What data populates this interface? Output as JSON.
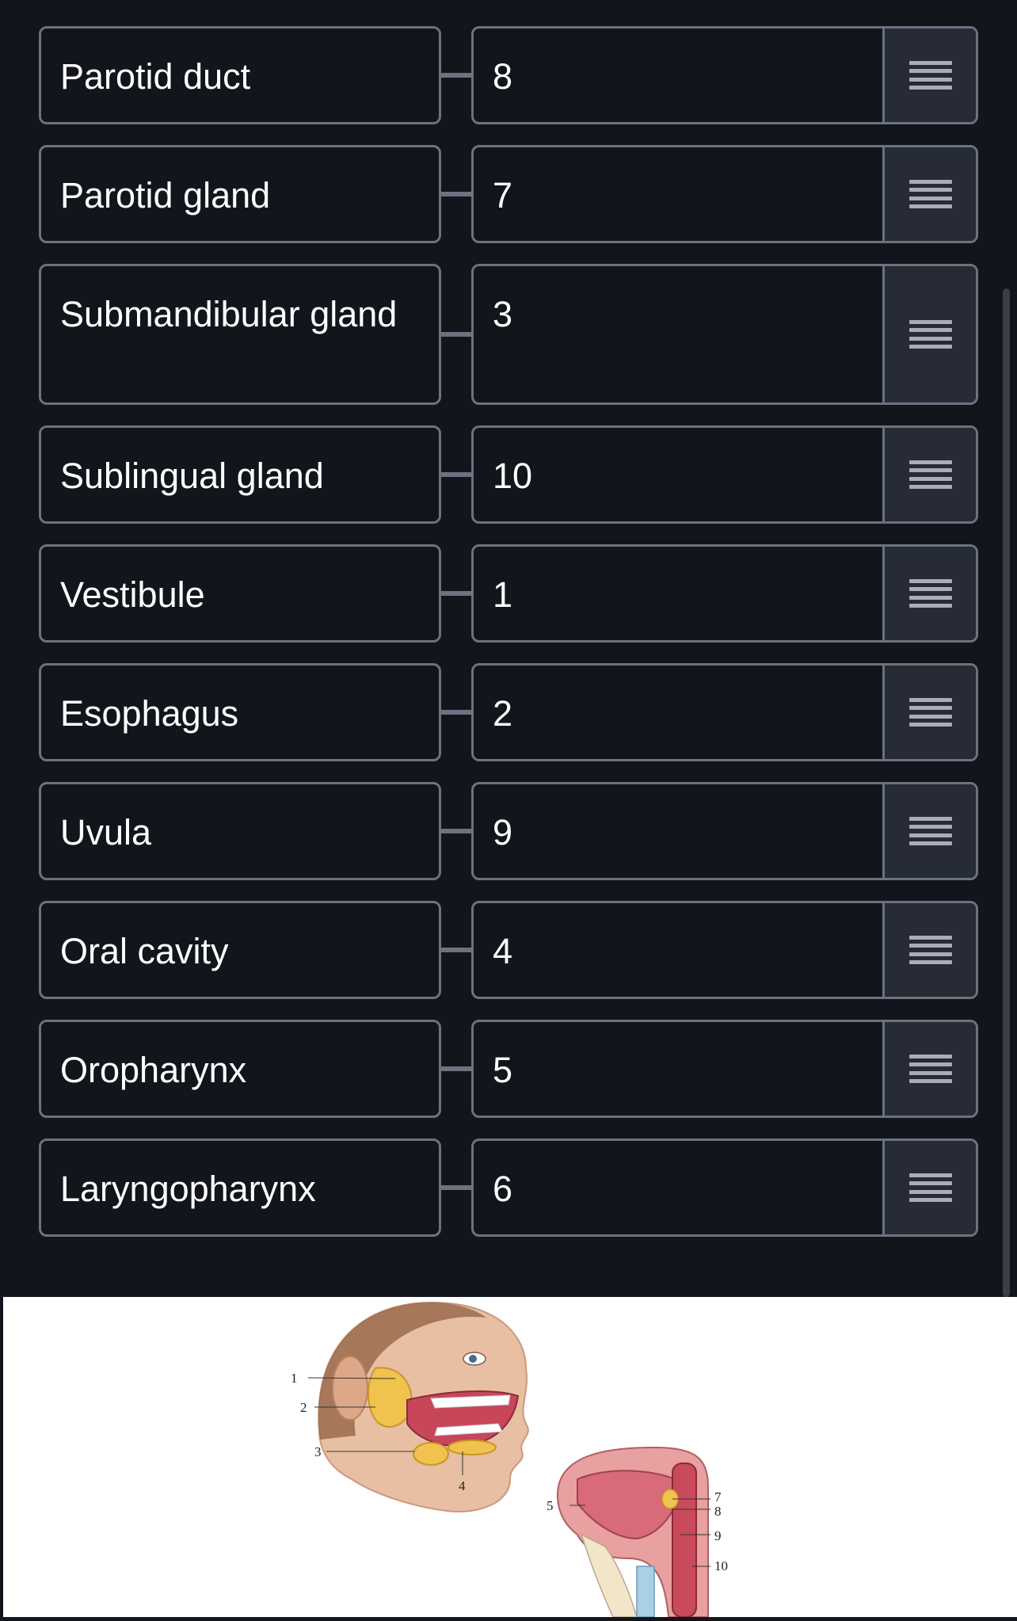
{
  "rows": [
    {
      "label": "Parotid duct",
      "answer": "8"
    },
    {
      "label": "Parotid gland",
      "answer": "7"
    },
    {
      "label": "Submandibular gland",
      "answer": "3"
    },
    {
      "label": "Sublingual gland",
      "answer": "10"
    },
    {
      "label": "Vestibule",
      "answer": "1"
    },
    {
      "label": "Esophagus",
      "answer": "2"
    },
    {
      "label": "Uvula",
      "answer": "9"
    },
    {
      "label": "Oral cavity",
      "answer": "4"
    },
    {
      "label": "Oropharynx",
      "answer": "5"
    },
    {
      "label": "Laryngopharynx",
      "answer": "6"
    }
  ],
  "figure": {
    "labels": [
      "1",
      "2",
      "3",
      "4",
      "5",
      "7",
      "8",
      "9",
      "10"
    ]
  },
  "colors": {
    "background": "#12151c",
    "border": "#6b7280",
    "handle_bg": "#262b35"
  },
  "icons": {
    "handle": "drag-handle-icon"
  }
}
